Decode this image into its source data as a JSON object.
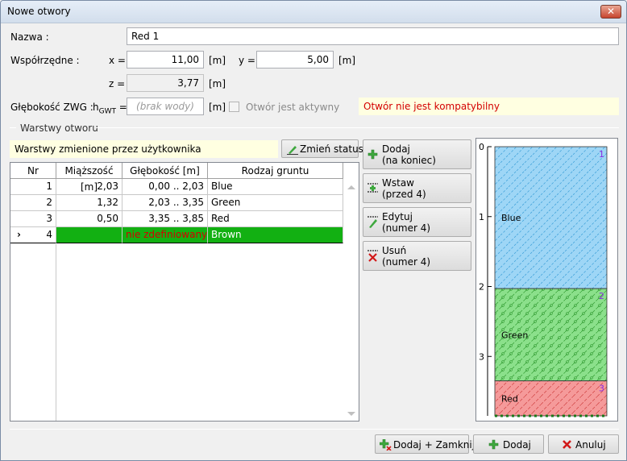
{
  "window": {
    "title": "Nowe otwory",
    "close_symbol": "✕"
  },
  "form": {
    "name_label": "Nazwa :",
    "name_value": "Red 1",
    "coords_label": "Współrzędne :",
    "x_label": "x =",
    "x_value": "11,00",
    "y_label": "y =",
    "y_value": "5,00",
    "z_label": "z =",
    "z_value": "3,77",
    "unit_m": "[m]",
    "gwt_label": "Głębokość ZWG :",
    "gwt_symbol": "h",
    "gwt_subscript": "GWT",
    "gwt_eq": " =",
    "gwt_placeholder": "(brak wody)",
    "active_label": "Otwór jest aktywny",
    "incompatible_warning": "Otwór nie jest kompatybilny"
  },
  "layers_group": {
    "title": "Warstwy otworu",
    "changed_notice": "Warstwy zmienione przez użytkownika",
    "change_status_button": "Zmień status",
    "columns": [
      "Nr",
      "Miąższość [m]",
      "Głębokość [m]",
      "Rodzaj gruntu"
    ],
    "rows": [
      {
        "nr": "1",
        "thickness": "2,03",
        "depth": "0,00 .. 2,03",
        "soil": "Blue"
      },
      {
        "nr": "2",
        "thickness": "1,32",
        "depth": "2,03 .. 3,35",
        "soil": "Green"
      },
      {
        "nr": "3",
        "thickness": "0,50",
        "depth": "3,35 .. 3,85",
        "soil": "Red"
      },
      {
        "nr": "4",
        "thickness": "",
        "depth": "nie zdefiniowany",
        "soil": "Brown"
      }
    ],
    "current_row_marker": "›"
  },
  "actions": {
    "add": {
      "line1": "Dodaj",
      "line2": "(na koniec)"
    },
    "insert": {
      "line1": "Wstaw",
      "line2": "(przed 4)"
    },
    "edit": {
      "line1": "Edytuj",
      "line2": "(numer 4)"
    },
    "remove": {
      "line1": "Usuń",
      "line2": "(numer 4)"
    }
  },
  "profile": {
    "depth_ticks": [
      "0",
      "1",
      "2",
      "3"
    ],
    "layers": [
      {
        "number": "1",
        "name": "Blue",
        "top": 0,
        "bottom": 2.03,
        "color": "#9ed6f6",
        "hatch": "#3a9fd8",
        "num_color": "#8a2be2"
      },
      {
        "number": "2",
        "name": "Green",
        "top": 2.03,
        "bottom": 3.35,
        "color": "#8be08b",
        "hatch": "#2f9a2f",
        "num_color": "#8a2be2"
      },
      {
        "number": "3",
        "name": "Red",
        "top": 3.35,
        "bottom": 3.85,
        "color": "#f59a9a",
        "hatch": "#d04040",
        "num_color": "#8a2be2"
      }
    ],
    "max_depth": 3.85
  },
  "footer": {
    "add_close_button": "Dodaj + Zamknij",
    "add_button": "Dodaj",
    "cancel_button": "Anuluj"
  },
  "colors": {
    "selected_row": "#12b012",
    "warning_red": "#d40000",
    "add_icon_green": "#3ea83e",
    "cancel_red": "#d21a1a"
  }
}
